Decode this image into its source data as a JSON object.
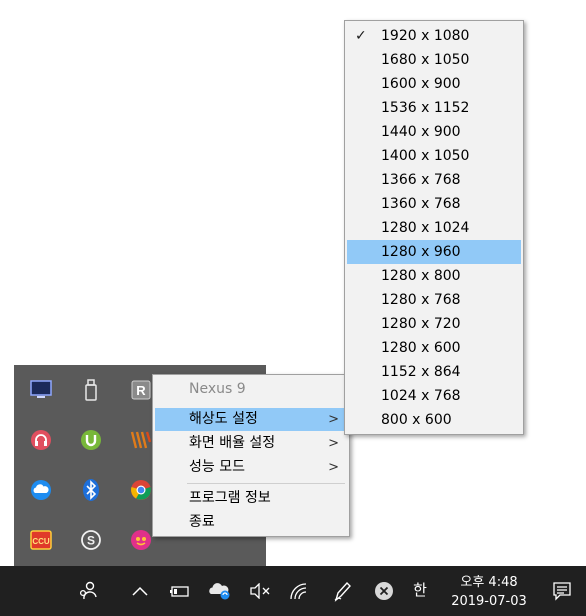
{
  "context_menu": {
    "items": [
      {
        "label": "Nexus 9",
        "disabled": true,
        "submenu": false
      },
      {
        "label": "해상도 설정",
        "submenu": true,
        "active": true
      },
      {
        "label": "화면 배율 설정",
        "submenu": true
      },
      {
        "label": "성능 모드",
        "submenu": true
      },
      {
        "label": "프로그램 정보",
        "submenu": false
      },
      {
        "label": "종료",
        "submenu": false
      }
    ],
    "submenu_arrow": ">"
  },
  "resolution_menu": {
    "check_mark": "✓",
    "checked_index": 0,
    "highlighted_index": 9,
    "items": [
      "1920 x 1080",
      "1680 x 1050",
      "1600 x 900",
      "1536 x 1152",
      "1440 x 900",
      "1400 x 1050",
      "1366 x 768",
      "1360 x 768",
      "1280 x 1024",
      "1280 x 960",
      "1280 x 800",
      "1280 x 768",
      "1280 x 720",
      "1280 x 600",
      "1152 x 864",
      "1024 x 768",
      "800 x 600"
    ]
  },
  "tray_icons": [
    "display-app-icon",
    "usb-drive-icon",
    "r-app-icon",
    "headset-icon",
    "utorrent-icon",
    "winamp-icon",
    "onedrive-icon",
    "bluetooth-icon",
    "chrome-icon",
    "cctv-app-icon",
    "skype-icon",
    "app-pink-icon"
  ],
  "taskbar": {
    "ime_label": "한",
    "clock_time": "오후 4:48",
    "clock_date": "2019-07-03"
  },
  "colors": {
    "highlight": "#91c9f7",
    "menu_bg": "#f2f2f2",
    "tray_bg": "#5a5a5a",
    "taskbar_bg": "#202020"
  }
}
